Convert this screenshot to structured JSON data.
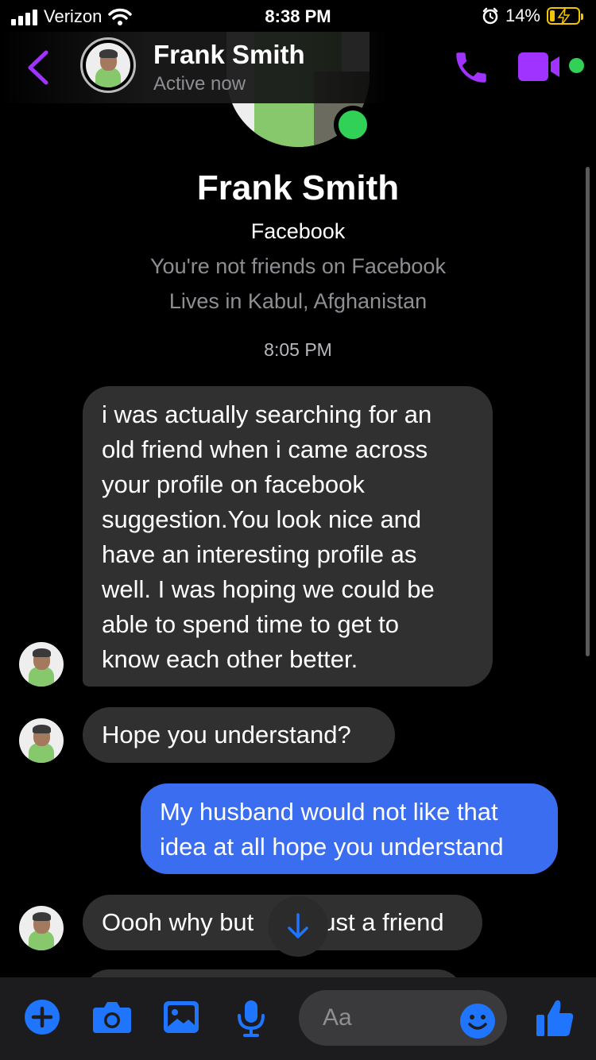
{
  "status_bar": {
    "carrier": "Verizon",
    "time": "8:38 PM",
    "battery": "14%"
  },
  "header": {
    "name": "Frank Smith",
    "status": "Active now"
  },
  "profile": {
    "name": "Frank Smith",
    "source": "Facebook",
    "friendship": "You're not friends on Facebook",
    "location": "Lives in Kabul, Afghanistan"
  },
  "conversation": {
    "timestamp": "8:05 PM",
    "messages": [
      {
        "from": "contact",
        "lines": [
          "i was actually searching for an",
          "old friend when i came across",
          "your profile on facebook",
          "suggestion.You look nice and",
          "have an interesting profile as",
          "well. I was hoping we could be",
          "able to spend time to get to",
          "know each other better."
        ]
      },
      {
        "from": "contact",
        "lines": [
          "Hope you understand?"
        ]
      },
      {
        "from": "me",
        "lines": [
          "My husband would not like that",
          "idea at all hope you understand"
        ]
      },
      {
        "from": "contact",
        "lines": [
          "Oooh why but",
          "ust a friend"
        ]
      }
    ]
  },
  "composer": {
    "placeholder": "Aa"
  },
  "colors": {
    "accent": "#a033ff",
    "composer_icons": "#1f75fe",
    "sent_bubble": "#3a6df0",
    "received_bubble": "#303030",
    "online": "#31d158"
  },
  "icons": [
    "back-chevron-icon",
    "phone-icon",
    "video-camera-icon",
    "plus-icon",
    "camera-icon",
    "image-icon",
    "microphone-icon",
    "emoji-icon",
    "thumbs-up-icon",
    "arrow-down-icon"
  ]
}
